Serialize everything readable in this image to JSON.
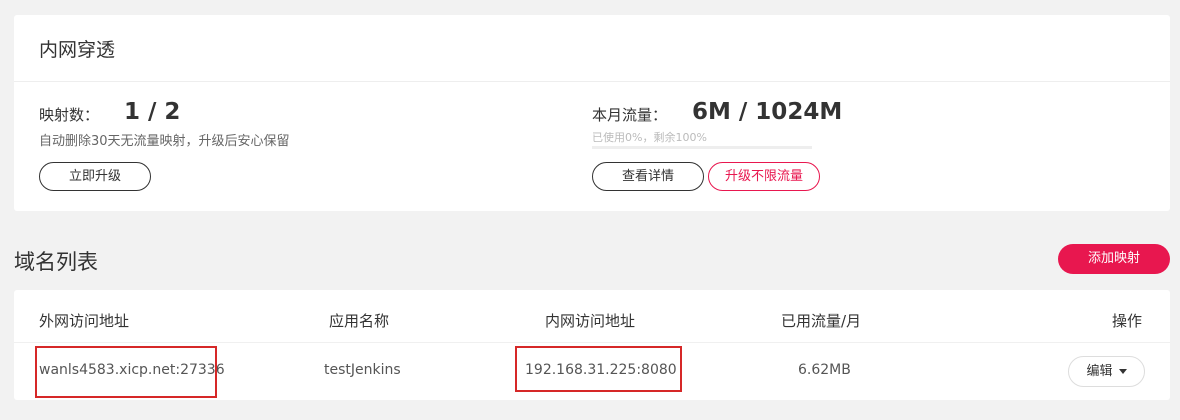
{
  "tunnel_card": {
    "title": "内网穿透",
    "mapping": {
      "label": "映射数：",
      "value": "1 / 2",
      "note": "自动删除30天无流量映射，升级后安心保留",
      "upgrade_button": "立即升级"
    },
    "traffic": {
      "label": "本月流量：",
      "value": "6M / 1024M",
      "usage_note": "已使用0%，剩余100%",
      "used_fraction": 0,
      "details_button": "查看详情",
      "unlimited_button": "升级不限流量"
    }
  },
  "domain_section": {
    "title": "域名列表",
    "add_button": "添加映射"
  },
  "table": {
    "headers": [
      "外网访问地址",
      "应用名称",
      "内网访问地址",
      "已用流量/月",
      "操作"
    ],
    "rows": [
      {
        "external": "wanls4583.xicp.net:27336",
        "app": "testJenkins",
        "internal": "192.168.31.225:8080",
        "traffic": "6.62MB",
        "action": "编辑"
      }
    ]
  },
  "colors": {
    "accent": "#e8174f",
    "highlight_box": "#d62828"
  }
}
